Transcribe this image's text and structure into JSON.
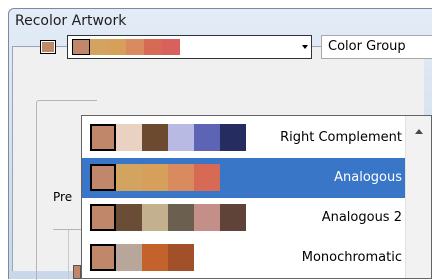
{
  "window": {
    "title": "Recolor Artwork"
  },
  "current_swatch_color": "#c0876a",
  "combo": {
    "colors": [
      "#c0876a",
      "#d2a460",
      "#d6a05b",
      "#d98a5e",
      "#d66a55",
      "#d9605c"
    ]
  },
  "group_select": {
    "value": "Color Group"
  },
  "panel": {
    "label": "Pre"
  },
  "harmony_rules": [
    {
      "label": "Right Complement",
      "colors": [
        "#c0876a",
        "#ead2c2",
        "#6c4a2f",
        "#b9bae3",
        "#5e64b5",
        "#252c5f"
      ],
      "selected": false
    },
    {
      "label": "Analogous",
      "colors": [
        "#c0876a",
        "#d2a460",
        "#d6a05b",
        "#d98a5e",
        "#d66a55"
      ],
      "selected": true
    },
    {
      "label": "Analogous 2",
      "colors": [
        "#c0876a",
        "#6a4d36",
        "#c2b08e",
        "#6b6050",
        "#c48e89",
        "#5f4339"
      ],
      "selected": false
    },
    {
      "label": "Monochromatic",
      "colors": [
        "#c0876a",
        "#b8a69a",
        "#c4622c",
        "#a2502a"
      ],
      "selected": false
    }
  ]
}
